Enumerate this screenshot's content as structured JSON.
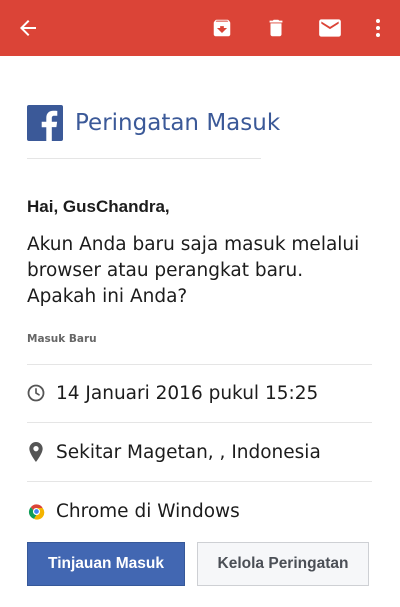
{
  "colors": {
    "appbar": "#db4437",
    "facebook_blue": "#3b5998",
    "primary_button": "#4267b2",
    "secondary_button": "#f6f7f9"
  },
  "toolbar": {
    "icons": [
      "back-arrow-icon",
      "archive-icon",
      "delete-icon",
      "mail-icon",
      "more-vert-icon"
    ]
  },
  "email": {
    "brand_icon": "facebook-logo-icon",
    "title": "Peringatan Masuk",
    "greeting": "Hai, GusChandra,",
    "message": "Akun Anda baru saja masuk melalui browser atau perangkat baru. Apakah ini Anda?",
    "section_label": "Masuk Baru",
    "details": [
      {
        "icon": "clock-icon",
        "text": "14 Januari 2016 pukul 15:25"
      },
      {
        "icon": "location-pin-icon",
        "text": "Sekitar Magetan, , Indonesia"
      },
      {
        "icon": "chrome-icon",
        "text": "Chrome di Windows"
      }
    ],
    "primary_button": "Tinjauan Masuk",
    "secondary_button": "Kelola Peringatan"
  }
}
